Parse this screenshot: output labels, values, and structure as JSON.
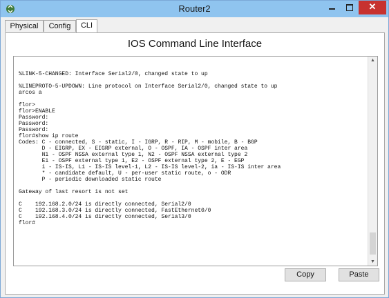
{
  "window": {
    "title": "Router2",
    "close_glyph": "✕"
  },
  "tabs": [
    "Physical",
    "Config",
    "CLI"
  ],
  "cli_title": "IOS Command Line Interface",
  "terminal": {
    "lines": [
      "",
      "%LINK-5-CHANGED: Interface Serial2/0, changed state to up",
      "",
      "%LINEPROTO-5-UPDOWN: Line protocol on Interface Serial2/0, changed state to up",
      "arcos a",
      "",
      "flor>",
      "flor>ENABLE",
      "Password:",
      "Password:",
      "Password:",
      "flor#show ip route",
      "Codes: C - connected, S - static, I - IGRP, R - RIP, M - mobile, B - BGP",
      "       D - EIGRP, EX - EIGRP external, O - OSPF, IA - OSPF inter area",
      "       N1 - OSPF NSSA external type 1, N2 - OSPF NSSA external type 2",
      "       E1 - OSPF external type 1, E2 - OSPF external type 2, E - EGP",
      "       i - IS-IS, L1 - IS-IS level-1, L2 - IS-IS level-2, ia - IS-IS inter area",
      "       * - candidate default, U - per-user static route, o - ODR",
      "       P - periodic downloaded static route",
      "",
      "Gateway of last resort is not set",
      "",
      "C    192.168.2.0/24 is directly connected, Serial2/0",
      "C    192.168.3.0/24 is directly connected, FastEthernet0/0",
      "C    192.168.4.0/24 is directly connected, Serial3/0",
      "flor#"
    ]
  },
  "buttons": {
    "copy": "Copy",
    "paste": "Paste"
  },
  "icons": {
    "app": "packet-tracer-router-icon",
    "minimize": "minimize-icon",
    "maximize": "maximize-icon",
    "close": "close-icon"
  },
  "colors": {
    "titlebar": "#8fc4ef",
    "close_button": "#c7322f"
  }
}
